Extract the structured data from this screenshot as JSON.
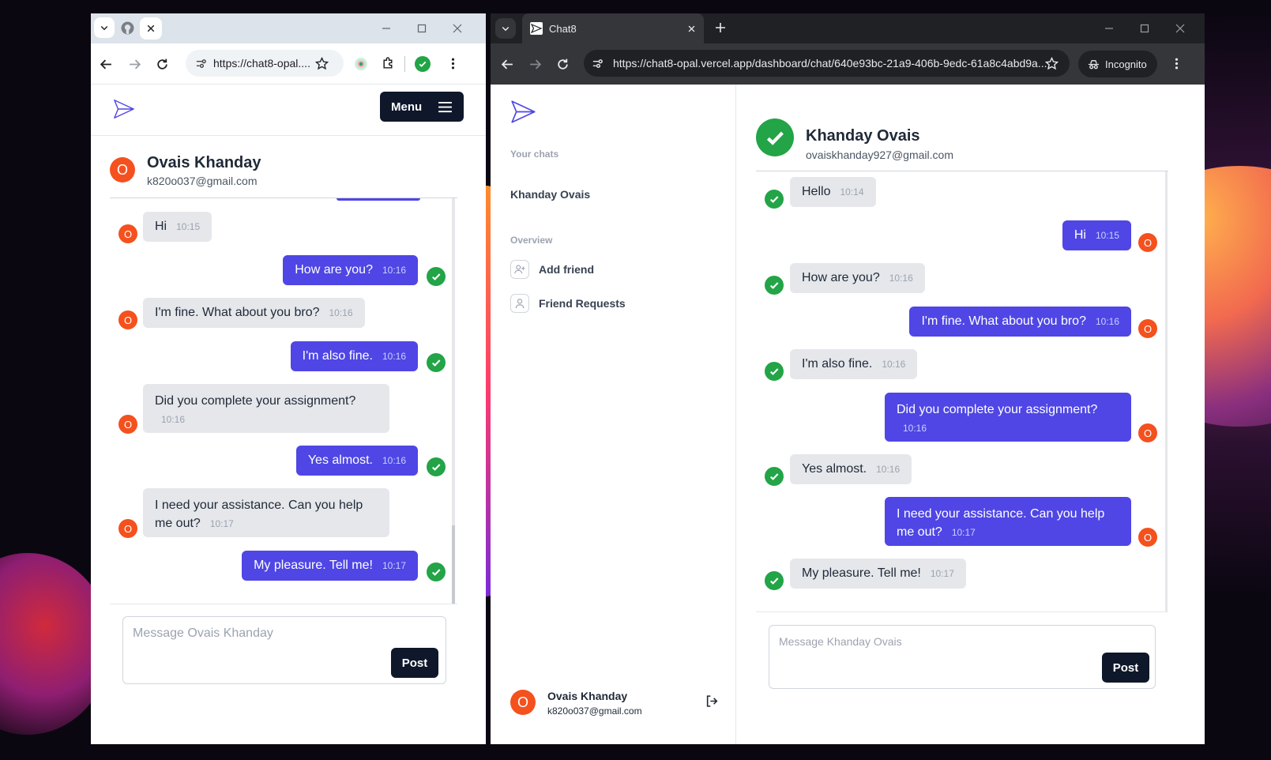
{
  "colors": {
    "accent": "#4f46e5",
    "avatar": "#f4511e",
    "check": "#22a447",
    "post": "#0f172a"
  },
  "win1": {
    "url": "https://chat8-opal....",
    "menu_label": "Menu",
    "contact": {
      "initial": "O",
      "name": "Ovais Khanday",
      "email": "k820o037@gmail.com"
    },
    "messages": [
      {
        "dir": "in",
        "text": "Hi",
        "time": "10:15"
      },
      {
        "dir": "out",
        "text": "How are you?",
        "time": "10:16"
      },
      {
        "dir": "in",
        "text": "I'm fine. What about you bro?",
        "time": "10:16"
      },
      {
        "dir": "out",
        "text": "I'm also fine.",
        "time": "10:16"
      },
      {
        "dir": "in",
        "text": "Did you complete your assignment?",
        "time": "10:16"
      },
      {
        "dir": "out",
        "text": "Yes almost.",
        "time": "10:16"
      },
      {
        "dir": "in",
        "text": "I need your assistance. Can you help me out?",
        "time": "10:17"
      },
      {
        "dir": "out",
        "text": "My pleasure. Tell me!",
        "time": "10:17"
      }
    ],
    "input_placeholder": "Message Ovais Khanday",
    "post_label": "Post"
  },
  "win2": {
    "tab_title": "Chat8",
    "url": "https://chat8-opal.vercel.app/dashboard/chat/640e93bc-21a9-406b-9edc-61a8c4abd9a...",
    "incognito_label": "Incognito",
    "sidebar": {
      "your_chats_label": "Your chats",
      "chats": [
        "Khanday Ovais"
      ],
      "overview_label": "Overview",
      "items": [
        {
          "label": "Add friend",
          "icon": "user-plus-icon"
        },
        {
          "label": "Friend Requests",
          "icon": "user-icon"
        }
      ],
      "user": {
        "initial": "O",
        "name": "Ovais Khanday",
        "email": "k820o037@gmail.com"
      }
    },
    "contact": {
      "name": "Khanday Ovais",
      "email": "ovaiskhanday927@gmail.com"
    },
    "messages": [
      {
        "dir": "in",
        "text": "Hello",
        "time": "10:14"
      },
      {
        "dir": "out",
        "text": "Hi",
        "time": "10:15"
      },
      {
        "dir": "in",
        "text": "How are you?",
        "time": "10:16"
      },
      {
        "dir": "out",
        "text": "I'm fine. What about you bro?",
        "time": "10:16"
      },
      {
        "dir": "in",
        "text": "I'm also fine.",
        "time": "10:16"
      },
      {
        "dir": "out",
        "text": "Did you complete your assignment?",
        "time": "10:16"
      },
      {
        "dir": "in",
        "text": "Yes almost.",
        "time": "10:16"
      },
      {
        "dir": "out",
        "text": "I need your assistance. Can you help me out?",
        "time": "10:17"
      },
      {
        "dir": "in",
        "text": "My pleasure. Tell me!",
        "time": "10:17"
      }
    ],
    "input_placeholder": "Message Khanday Ovais",
    "post_label": "Post"
  }
}
